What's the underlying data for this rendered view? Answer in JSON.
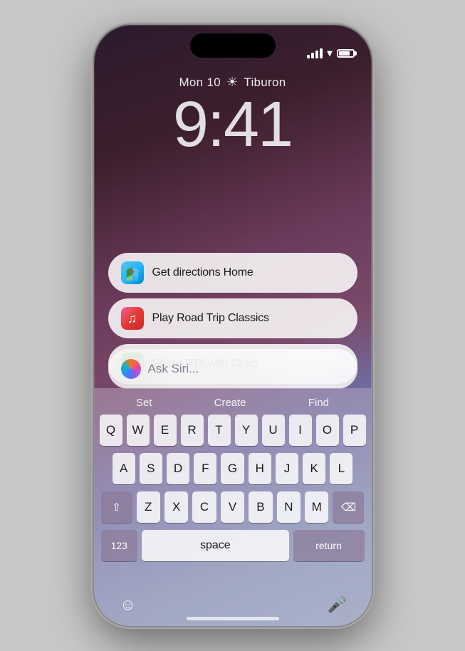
{
  "phone": {
    "status_bar": {
      "signal_label": "signal",
      "wifi_label": "wifi",
      "battery_label": "battery"
    },
    "lock_screen": {
      "date": "Mon 10",
      "weather_icon": "☀",
      "location": "Tiburon",
      "time": "9:41"
    },
    "suggestions": [
      {
        "id": "directions",
        "app": "Maps",
        "app_color": "maps",
        "text": "Get directions Home"
      },
      {
        "id": "music",
        "app": "Music",
        "app_color": "music",
        "text": "Play Road Trip Classics"
      },
      {
        "id": "messages",
        "app": "Messages",
        "app_color": "messages",
        "text": "Share ETA with Chad"
      }
    ],
    "siri_input": {
      "placeholder": "Ask Siri..."
    },
    "keyboard": {
      "shortcuts": [
        "Set",
        "Create",
        "Find"
      ],
      "rows": [
        [
          "Q",
          "W",
          "E",
          "R",
          "T",
          "Y",
          "U",
          "I",
          "O",
          "P"
        ],
        [
          "A",
          "S",
          "D",
          "F",
          "G",
          "H",
          "J",
          "K",
          "L"
        ],
        [
          "Z",
          "X",
          "C",
          "V",
          "B",
          "N",
          "M"
        ],
        [
          "123",
          "space",
          "return"
        ]
      ],
      "bottom": {
        "emoji_label": "emoji",
        "mic_label": "mic",
        "space_label": "space",
        "return_label": "return",
        "num_label": "123",
        "shift_label": "shift",
        "delete_label": "delete"
      }
    }
  }
}
